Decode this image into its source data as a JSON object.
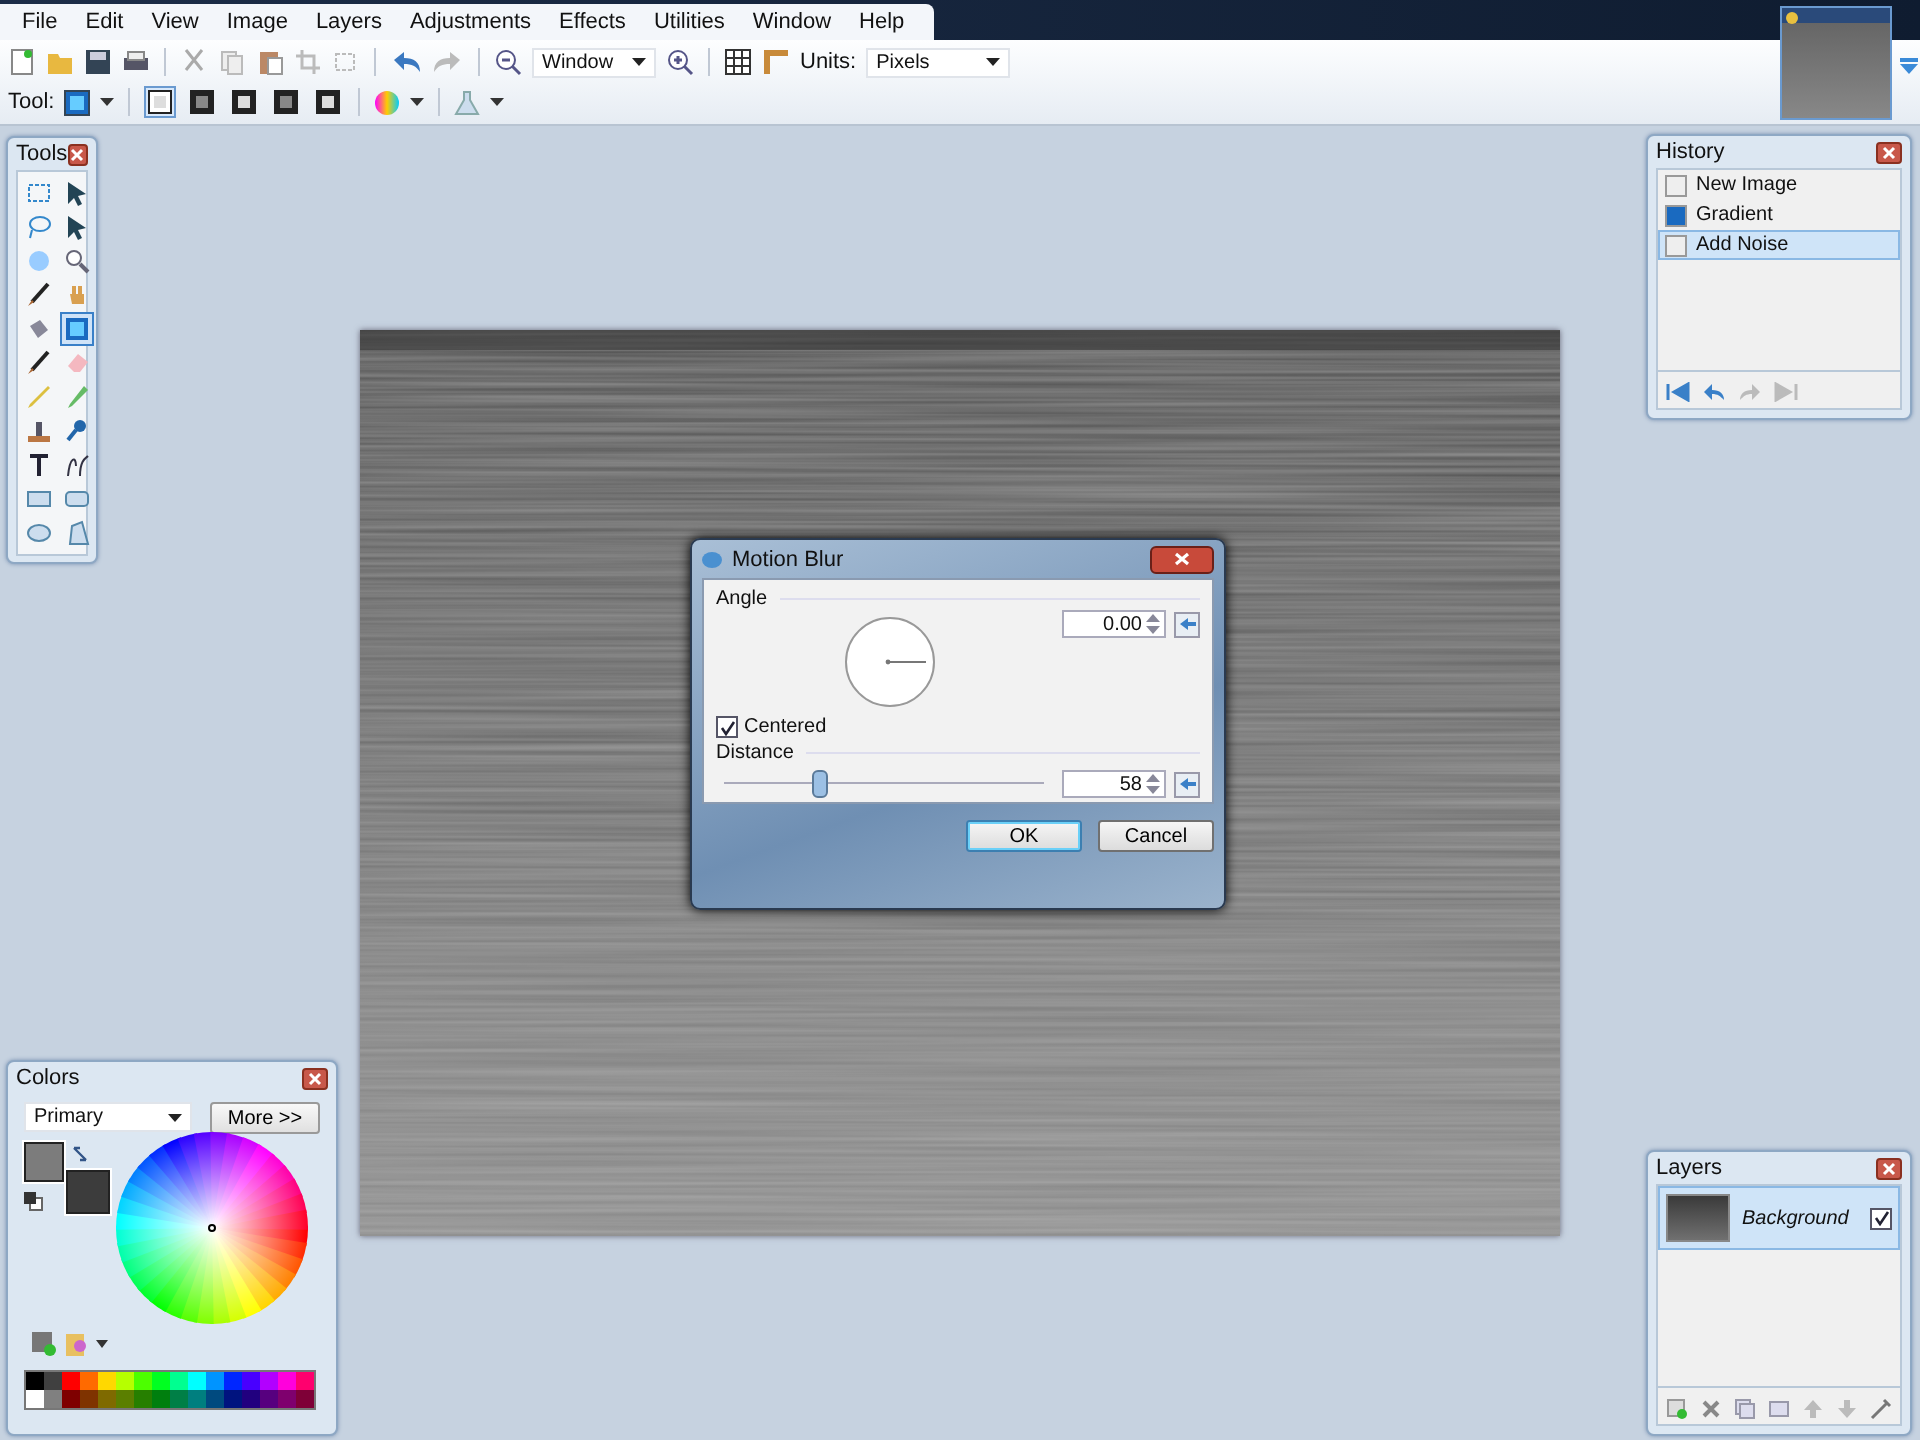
{
  "menu": [
    {
      "label": "File"
    },
    {
      "label": "Edit"
    },
    {
      "label": "View"
    },
    {
      "label": "Image"
    },
    {
      "label": "Layers"
    },
    {
      "label": "Adjustments"
    },
    {
      "label": "Effects"
    },
    {
      "label": "Utilities"
    },
    {
      "label": "Window"
    },
    {
      "label": "Help"
    }
  ],
  "toolbar": {
    "zoom": "Window",
    "units_label": "Units:",
    "units": "Pixels"
  },
  "toolbar2": {
    "tool_label": "Tool:",
    "modes": [
      {
        "selected": true
      },
      {
        "selected": false
      },
      {
        "selected": false
      },
      {
        "selected": false
      },
      {
        "selected": false
      }
    ]
  },
  "tools_panel": {
    "title": "Tools",
    "tools": [
      {
        "selected": false
      },
      {
        "selected": false
      },
      {
        "selected": false
      },
      {
        "selected": false
      },
      {
        "selected": false
      },
      {
        "selected": false
      },
      {
        "selected": false
      },
      {
        "selected": false
      },
      {
        "selected": false
      },
      {
        "selected": true
      },
      {
        "selected": false
      },
      {
        "selected": false
      },
      {
        "selected": false
      },
      {
        "selected": false
      },
      {
        "selected": false
      },
      {
        "selected": false
      },
      {
        "selected": false
      },
      {
        "selected": false
      },
      {
        "selected": false
      },
      {
        "selected": false
      },
      {
        "selected": false
      },
      {
        "selected": false
      }
    ]
  },
  "history_panel": {
    "title": "History",
    "items": [
      {
        "label": "New Image",
        "selected": false
      },
      {
        "label": "Gradient",
        "selected": false
      },
      {
        "label": "Add Noise",
        "selected": true
      }
    ]
  },
  "dialog": {
    "title": "Motion Blur",
    "angle_label": "Angle",
    "angle_value": "0.00",
    "centered": {
      "label": "Centered",
      "checked": true
    },
    "distance_label": "Distance",
    "distance_value": "58",
    "distance_slider": {
      "level": 0.3
    },
    "buttons": [
      {
        "label": "OK",
        "selected": true
      },
      {
        "label": "Cancel",
        "selected": false
      }
    ]
  },
  "colors_panel": {
    "title": "Colors",
    "dropdown": "Primary",
    "more_button": "More >>",
    "swatches": [
      {
        "color": "#7c7c7c"
      },
      {
        "color": "#3c3c3c"
      }
    ],
    "palette": [
      {
        "color": "#000000"
      },
      {
        "color": "#404040"
      },
      {
        "color": "#ff0000"
      },
      {
        "color": "#ff6a00"
      },
      {
        "color": "#ffd800"
      },
      {
        "color": "#b6ff00"
      },
      {
        "color": "#4cff00"
      },
      {
        "color": "#00ff21"
      },
      {
        "color": "#00ff90"
      },
      {
        "color": "#00ffff"
      },
      {
        "color": "#0094ff"
      },
      {
        "color": "#0026ff"
      },
      {
        "color": "#4800ff"
      },
      {
        "color": "#b200ff"
      },
      {
        "color": "#ff00dc"
      },
      {
        "color": "#ff006e"
      },
      {
        "color": "#ffffff"
      },
      {
        "color": "#808080"
      },
      {
        "color": "#7f0000"
      },
      {
        "color": "#7f3300"
      },
      {
        "color": "#7f6a00"
      },
      {
        "color": "#5b7f00"
      },
      {
        "color": "#267f00"
      },
      {
        "color": "#007f0e"
      },
      {
        "color": "#007f46"
      },
      {
        "color": "#007f7f"
      },
      {
        "color": "#004a7f"
      },
      {
        "color": "#00137f"
      },
      {
        "color": "#21007f"
      },
      {
        "color": "#57007f"
      },
      {
        "color": "#7f006e"
      },
      {
        "color": "#7f0037"
      }
    ]
  },
  "layers_panel": {
    "title": "Layers",
    "layers": [
      {
        "name": "Background",
        "visible": true,
        "selected": true
      }
    ]
  }
}
